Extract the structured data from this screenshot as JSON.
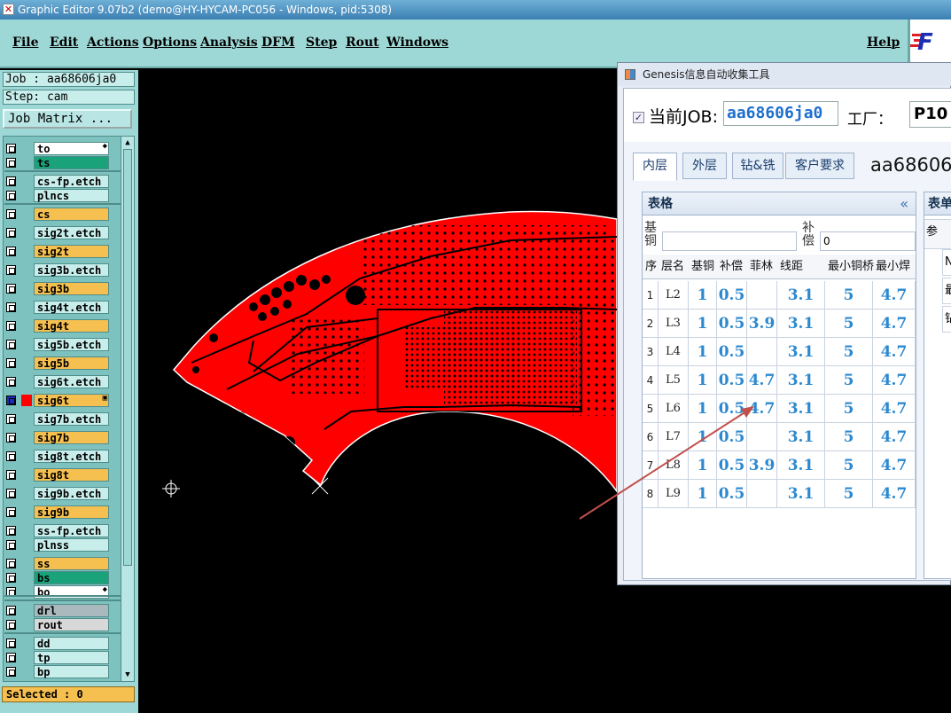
{
  "window": {
    "title": "Graphic Editor 9.07b2 (demo@HY-HYCAM-PC056 - Windows, pid:5308)"
  },
  "menu": {
    "items": [
      "File",
      "Edit",
      "Actions",
      "Options",
      "Analysis",
      "DFM",
      "Step",
      "Rout",
      "Windows"
    ],
    "help": "Help"
  },
  "left": {
    "job": "Job : aa68606ja0",
    "step": "Step: cam",
    "job_matrix": "Job Matrix ...",
    "selected": "Selected : 0"
  },
  "layers": [
    {
      "name": "to",
      "color": "#ffffff",
      "mark": "◆"
    },
    {
      "name": "ts",
      "color": "#1aa37a"
    },
    {
      "name": "cs-fp.etch",
      "color": "#c8eeec"
    },
    {
      "name": "plncs",
      "color": "#c8eeec"
    },
    {
      "name": "cs",
      "color": "#f6c050"
    },
    {
      "name": "sig2t.etch",
      "color": "#c8eeec"
    },
    {
      "name": "sig2t",
      "color": "#f6c050"
    },
    {
      "name": "sig3b.etch",
      "color": "#c8eeec"
    },
    {
      "name": "sig3b",
      "color": "#f6c050"
    },
    {
      "name": "sig4t.etch",
      "color": "#c8eeec"
    },
    {
      "name": "sig4t",
      "color": "#f6c050"
    },
    {
      "name": "sig5b.etch",
      "color": "#c8eeec"
    },
    {
      "name": "sig5b",
      "color": "#f6c050"
    },
    {
      "name": "sig6t.etch",
      "color": "#c8eeec"
    },
    {
      "name": "sig6t",
      "color": "#f6c050",
      "active": true,
      "mark": "▣"
    },
    {
      "name": "sig7b.etch",
      "color": "#c8eeec"
    },
    {
      "name": "sig7b",
      "color": "#f6c050"
    },
    {
      "name": "sig8t.etch",
      "color": "#c8eeec"
    },
    {
      "name": "sig8t",
      "color": "#f6c050"
    },
    {
      "name": "sig9b.etch",
      "color": "#c8eeec"
    },
    {
      "name": "sig9b",
      "color": "#f6c050"
    },
    {
      "name": "ss-fp.etch",
      "color": "#c8eeec"
    },
    {
      "name": "plnss",
      "color": "#c8eeec"
    },
    {
      "name": "ss",
      "color": "#f6c050"
    },
    {
      "name": "bs",
      "color": "#1aa37a"
    },
    {
      "name": "bo",
      "color": "#ffffff",
      "mark": "◆"
    },
    {
      "name": "drl",
      "color": "#a9b9bd"
    },
    {
      "name": "rout",
      "color": "#d8d8d8"
    },
    {
      "name": "dd",
      "color": "#c8eeec"
    },
    {
      "name": "tp",
      "color": "#c8eeec"
    },
    {
      "name": "bp",
      "color": "#c8eeec"
    }
  ],
  "colors": {
    "board": "#ff0000",
    "canvas": "#000000",
    "panel": "#9ed8d6",
    "accent": "#2c89cf"
  },
  "tool": {
    "title": "Genesis信息自动收集工具",
    "job_label": "当前JOB:",
    "job_value": "aa68606ja0",
    "factory_label": "工厂：",
    "factory_value": "P10",
    "tabs": [
      "内层",
      "外层",
      "钻&铣",
      "客户要求"
    ],
    "job_big": "aa68606",
    "panel_title": "表格",
    "collapse": "«",
    "field_copper_label": "基铜",
    "field_copper_value": "",
    "field_comp_label": "补偿",
    "field_comp_value": "0",
    "columns": [
      "序",
      "层名",
      "基铜",
      "补偿",
      "菲林",
      "线距",
      "最小铜桥",
      "最小焊"
    ],
    "rows": [
      [
        "1",
        "L2",
        "1",
        "0.5",
        "",
        "3.1",
        "5",
        "4.7"
      ],
      [
        "2",
        "L3",
        "1",
        "0.5",
        "3.9",
        "3.1",
        "5",
        "4.7"
      ],
      [
        "3",
        "L4",
        "1",
        "0.5",
        "",
        "3.1",
        "5",
        "4.7"
      ],
      [
        "4",
        "L5",
        "1",
        "0.5",
        "4.7",
        "3.1",
        "5",
        "4.7"
      ],
      [
        "5",
        "L6",
        "1",
        "0.5",
        "4.7",
        "3.1",
        "5",
        "4.7"
      ],
      [
        "6",
        "L7",
        "1",
        "0.5",
        "",
        "3.1",
        "5",
        "4.7"
      ],
      [
        "7",
        "L8",
        "1",
        "0.5",
        "3.9",
        "3.1",
        "5",
        "4.7"
      ],
      [
        "8",
        "L9",
        "1",
        "0.5",
        "",
        "3.1",
        "5",
        "4.7"
      ]
    ],
    "panel2_title": "表单",
    "panel2_head": "参",
    "panel2_cells": [
      "N",
      "最",
      "钻"
    ]
  }
}
